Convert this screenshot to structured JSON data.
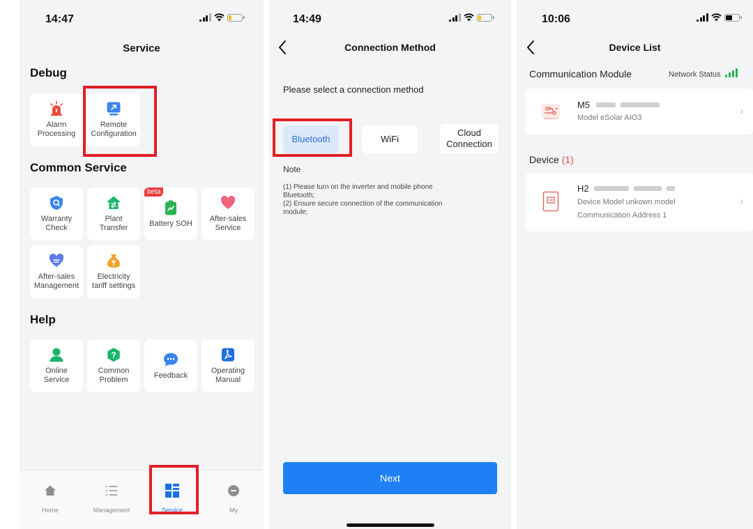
{
  "screen1": {
    "status_time": "14:47",
    "title": "Service",
    "sections": {
      "debug": "Debug",
      "common": "Common Service",
      "help": "Help"
    },
    "debug_items": [
      {
        "label": "Alarm\nProcessing",
        "icon": "alarm-siren-icon"
      },
      {
        "label": "Remote\nConfiguration",
        "icon": "remote-config-icon"
      }
    ],
    "common_items": [
      {
        "label": "Warranty\nCheck",
        "icon": "shield-icon"
      },
      {
        "label": "Plant\nTransfer",
        "icon": "home-transfer-icon"
      },
      {
        "label": "Battery SOH",
        "icon": "battery-chart-icon",
        "badge": "beta"
      },
      {
        "label": "After-sales\nService",
        "icon": "heart-icon"
      },
      {
        "label": "After-sales\nManagement",
        "icon": "heart-list-icon"
      },
      {
        "label": "Electricity\ntariff settings",
        "icon": "money-bag-icon"
      }
    ],
    "help_items": [
      {
        "label": "Online\nService",
        "icon": "person-support-icon"
      },
      {
        "label": "Common\nProblem",
        "icon": "question-icon"
      },
      {
        "label": "Feedback",
        "icon": "chat-bubble-icon"
      },
      {
        "label": "Operating\nManual",
        "icon": "pdf-manual-icon"
      }
    ],
    "tabs": [
      {
        "label": "Home",
        "icon": "home-icon"
      },
      {
        "label": "Management",
        "icon": "list-icon"
      },
      {
        "label": "Service",
        "icon": "grid-icon",
        "active": true
      },
      {
        "label": "My",
        "icon": "profile-icon"
      }
    ]
  },
  "screen2": {
    "status_time": "14:49",
    "title": "Connection Method",
    "prompt": "Please select a connection method",
    "options": [
      {
        "label": "Bluetooth",
        "selected": true
      },
      {
        "label": "WiFi",
        "selected": false
      },
      {
        "label": "Cloud\nConnection",
        "selected": false
      }
    ],
    "note_title": "Note",
    "note_text": "(1) Please turn on the inverter and mobile phone Bluetooth;\n(2) Ensure secure connection of the communication module;",
    "next_label": "Next"
  },
  "screen3": {
    "status_time": "10:06",
    "title": "Device List",
    "module_header": "Communication Module",
    "network_status": "Network Status",
    "module": {
      "name_prefix": "M5",
      "model_label": "Model",
      "model_value": "eSolar AIO3"
    },
    "device_header": "Device",
    "device_count": "(1)",
    "device": {
      "name_prefix": "H2",
      "model_label": "Device Model",
      "model_value": "unkown model",
      "addr_label": "Communication Address",
      "addr_value": "1"
    }
  },
  "colors": {
    "accent_blue": "#1d80f5",
    "highlight_red": "#e21f26",
    "network_green": "#22b14c",
    "device_count_red": "#e24b4b"
  }
}
